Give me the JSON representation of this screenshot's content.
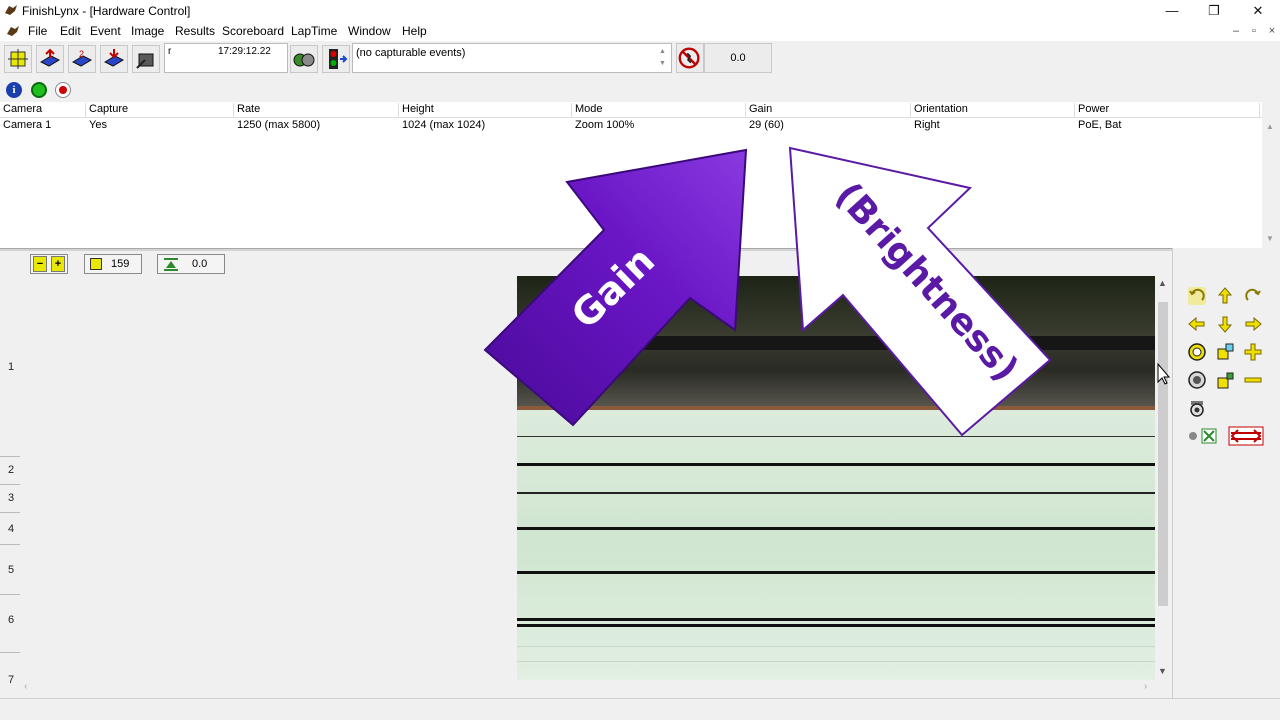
{
  "window": {
    "title": "FinishLynx - [Hardware Control]",
    "controls": {
      "minimize": "—",
      "restore": "❐",
      "close": "✕"
    }
  },
  "menu": {
    "items": [
      {
        "label": "File"
      },
      {
        "label": "Edit"
      },
      {
        "label": "Event"
      },
      {
        "label": "Image"
      },
      {
        "label": "Results"
      },
      {
        "label": "Scoreboard"
      },
      {
        "label": "LapTime"
      },
      {
        "label": "Window"
      },
      {
        "label": "Help"
      }
    ],
    "mdi_controls": {
      "minimize": "–",
      "restore": "▫",
      "close": "×"
    }
  },
  "toolbar": {
    "clock_prefix": "r",
    "clock": "17:29:12.22",
    "events_text": "(no capturable events)",
    "false_start_value": "0.0"
  },
  "camera_table": {
    "columns": [
      "Camera",
      "Capture",
      "Rate",
      "Height",
      "Mode",
      "Gain",
      "Orientation",
      "Power"
    ],
    "rows": [
      [
        "Camera 1",
        "Yes",
        "1250  (max 5800)",
        "1024  (max 1024)",
        "Zoom 100%",
        "29  (60)",
        "Right",
        "PoE, Bat"
      ]
    ]
  },
  "image_toolbar": {
    "density_value": "159",
    "offset_value": "0.0"
  },
  "ruler": {
    "labels": [
      "1",
      "2",
      "3",
      "4",
      "5",
      "6",
      "7"
    ]
  },
  "annotations": {
    "gain_arrow_text": "Gain",
    "brightness_arrow_text": "(Brightness)",
    "gain_color": "#6a12c6",
    "brightness_color": "#ffffff"
  },
  "icons": {
    "info": "info-icon",
    "status_ok": "green-status-icon",
    "record": "record-icon"
  }
}
